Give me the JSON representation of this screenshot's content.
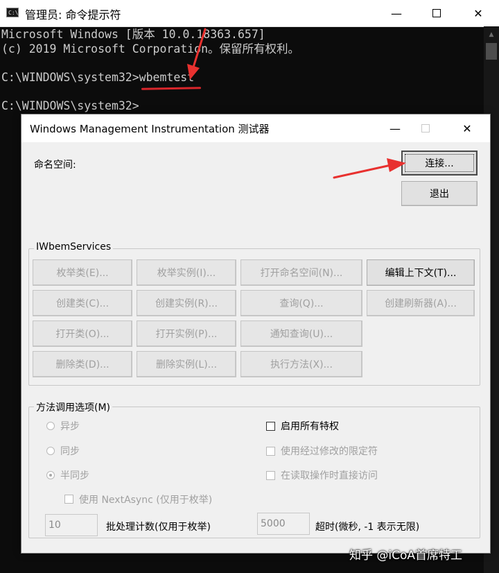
{
  "cmd": {
    "title": "管理员: 命令提示符",
    "icon_label": "C:\\",
    "lines": [
      "Microsoft Windows [版本 10.0.18363.657]",
      "(c) 2019 Microsoft Corporation。保留所有权利。",
      "C:\\WINDOWS\\system32>wbemtest",
      "C:\\WINDOWS\\system32>"
    ],
    "caption": {
      "minimize": "—",
      "close": "✕"
    }
  },
  "wmi": {
    "title": "Windows Management Instrumentation 测试器",
    "namespace_label": "命名空间:",
    "connect_label": "连接...",
    "exit_label": "退出",
    "services_group": "IWbemServices",
    "services_buttons": [
      [
        "枚举类(E)...",
        "枚举实例(I)...",
        "打开命名空间(N)...",
        "编辑上下文(T)..."
      ],
      [
        "创建类(C)...",
        "创建实例(R)...",
        "查询(Q)...",
        "创建刷新器(A)..."
      ],
      [
        "打开类(O)...",
        "打开实例(P)...",
        "通知查询(U)..."
      ],
      [
        "删除类(D)...",
        "删除实例(L)...",
        "执行方法(X)..."
      ]
    ],
    "options_group": "方法调用选项(M)",
    "radio_async": "异步",
    "radio_sync": "同步",
    "radio_semisync": "半同步",
    "chk_enable_privileges": "启用所有特权",
    "chk_amended_qualifiers": "使用经过修改的限定符",
    "chk_direct_read": "在读取操作时直接访问",
    "chk_next_async": "使用 NextAsync (仅用于枚举)",
    "batch_value": "10",
    "batch_label": "批处理计数(仅用于枚举)",
    "timeout_value": "5000",
    "timeout_label": "超时(微秒, -1 表示无限)",
    "caption": {
      "minimize": "—",
      "close": "✕"
    }
  },
  "watermark": "知乎 @iCoA首席特工",
  "colors": {
    "console_bg": "#0c0c0c",
    "console_text": "#cccccc",
    "annotation_red": "#e8312f",
    "dialog_bg": "#f0f0f0"
  }
}
